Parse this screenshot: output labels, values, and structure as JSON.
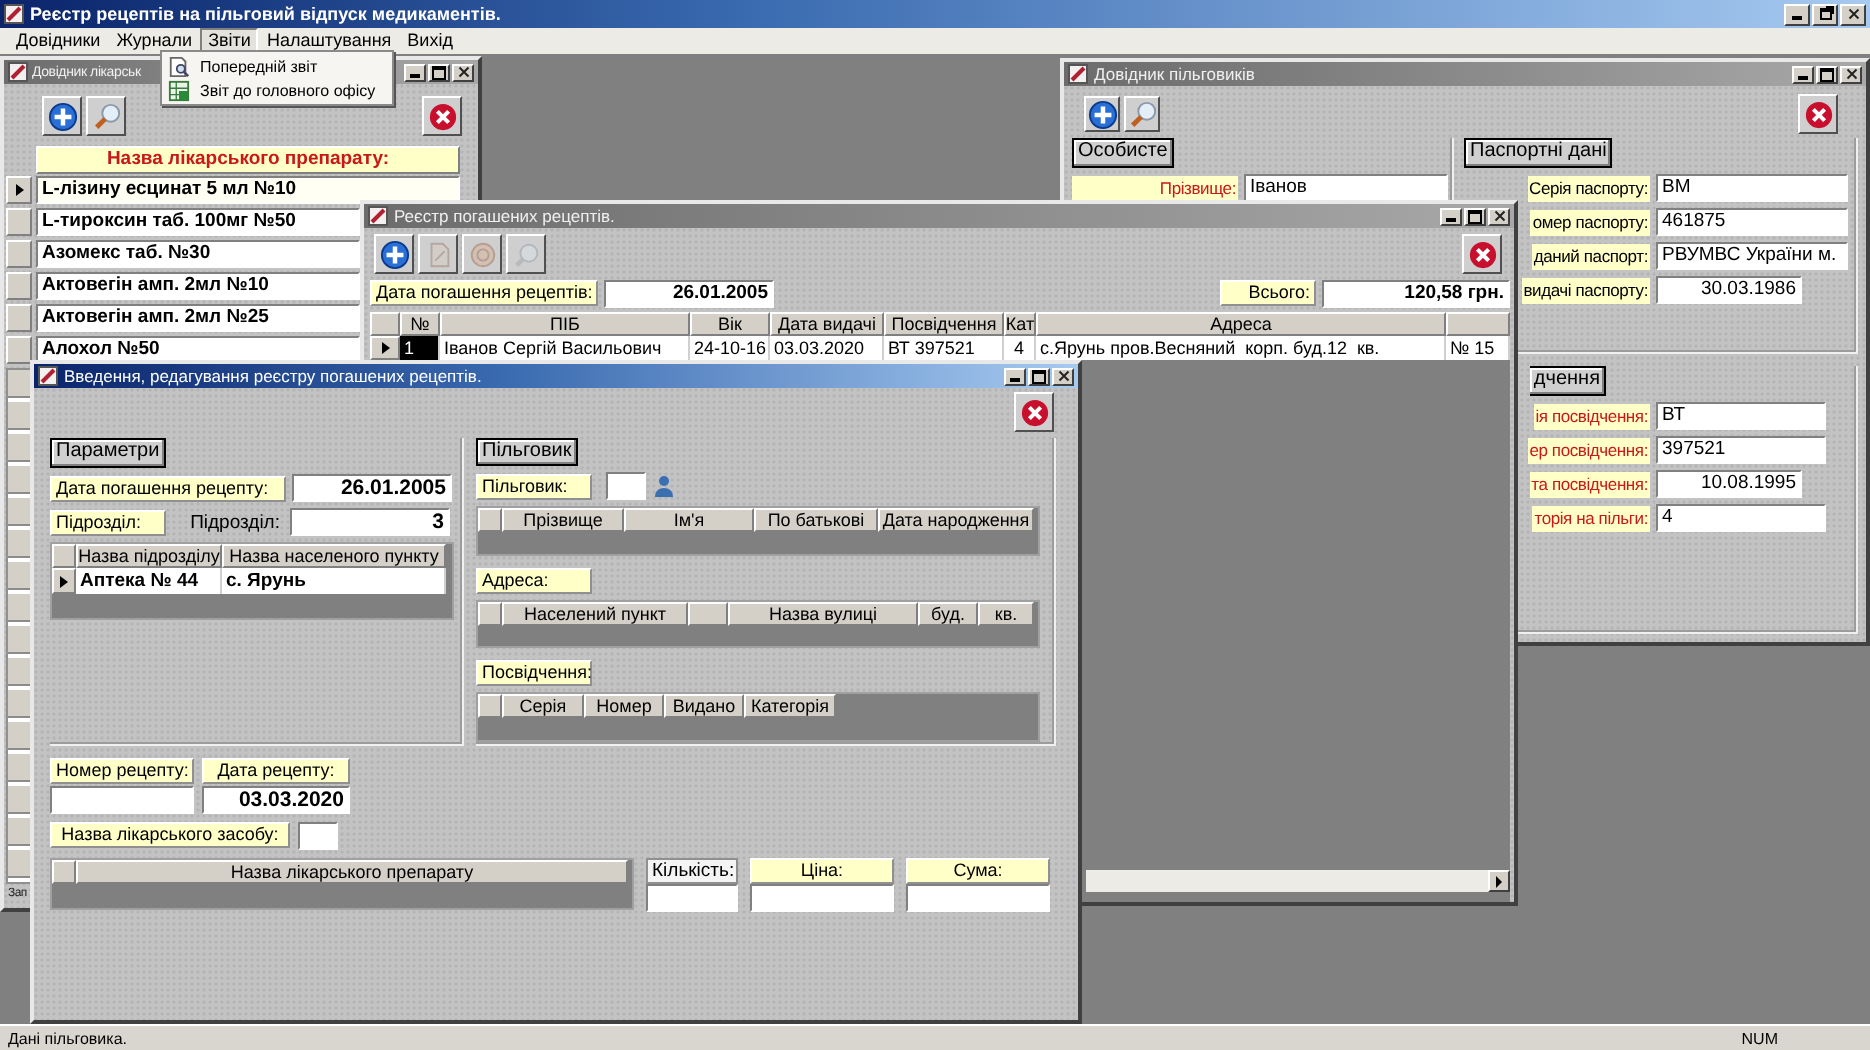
{
  "app": {
    "title": "Реєстр рецептів на пільговий відпуск медикаментів."
  },
  "menu": [
    {
      "label": "Довідники",
      "selected": false
    },
    {
      "label": "Журнали",
      "selected": false
    },
    {
      "label": "Звіти",
      "selected": true
    },
    {
      "label": "Налаштування",
      "selected": false
    },
    {
      "label": "Вихід",
      "selected": false
    }
  ],
  "dropdown": [
    {
      "label": "Попередній звіт",
      "kind": "preview"
    },
    {
      "label": "Звіт до головного офісу",
      "kind": "export"
    }
  ],
  "drug_window": {
    "title": "Довідник лікарськ",
    "active": false,
    "header": "Назва лікарського препарату:",
    "footer": "Зап",
    "rows": [
      {
        "name": "L-лізину есцинат 5 мл №10",
        "selected": true
      },
      {
        "name": "L-тироксин таб. 100мг №50",
        "selected": false
      },
      {
        "name": "Азомекс таб. №30",
        "selected": false
      },
      {
        "name": "Актовегін амп. 2мл №10",
        "selected": false
      },
      {
        "name": "Актовегін амп. 2мл №25",
        "selected": false
      },
      {
        "name": "Алохол №50",
        "selected": false
      }
    ]
  },
  "beneficiary_window": {
    "title": "Довідник пільговиків",
    "active": false,
    "personal": {
      "legend": "Особисте",
      "fields": [
        {
          "label": "Прізвище:",
          "value": "Іванов",
          "required": true
        }
      ]
    },
    "passport": {
      "legend": "Паспортні дані",
      "fields": [
        {
          "label": "Серія паспорту:",
          "value": "ВМ",
          "required": false,
          "kind": "text"
        },
        {
          "label": "омер паспорту:",
          "value": "461875",
          "required": false,
          "kind": "text"
        },
        {
          "label": "даний паспорт:",
          "value": "РВУМВС України м.",
          "required": false,
          "kind": "text"
        },
        {
          "label": "видачі паспорту:",
          "value": "30.03.1986",
          "required": false,
          "kind": "date"
        }
      ]
    },
    "certificate": {
      "legend": "дчення",
      "fields": [
        {
          "label": "ія посвідчення:",
          "value": "ВТ",
          "required": true,
          "kind": "text"
        },
        {
          "label": "ер посвідчення:",
          "value": "397521",
          "required": true,
          "kind": "text"
        },
        {
          "label": "та посвідчення:",
          "value": "10.08.1995",
          "required": true,
          "kind": "date"
        },
        {
          "label": "торія на пільги:",
          "value": "4",
          "required": true,
          "kind": "text"
        }
      ]
    }
  },
  "registry_window": {
    "title": "Реєстр погашених рецептів.",
    "active": false,
    "tools": [
      {
        "kind": "add",
        "disabled": false
      },
      {
        "kind": "edit",
        "disabled": true
      },
      {
        "kind": "delete",
        "disabled": true
      },
      {
        "kind": "search",
        "disabled": true
      }
    ],
    "date_label": "Дата погашення рецептів:",
    "date": "26.01.2005",
    "total_label": "Всього:",
    "total": "120,58 грн.",
    "columns": [
      "№",
      "ПІБ",
      "Вік",
      "Дата видачі",
      "Посвідчення",
      "Кат",
      "Адреса"
    ],
    "rows": [
      {
        "selected": true,
        "cells": [
          "1",
          "Іванов Сергій Васильович",
          "24-10-16",
          "03.03.2020",
          "ВТ 397521",
          "4",
          "с.Ярунь пров.Весняний  корп. буд.12  кв.",
          "№ 15"
        ]
      }
    ]
  },
  "entry_window": {
    "title": "Введення, редагування реєстру погашених рецептів.",
    "active": true,
    "params": {
      "legend": "Параметри",
      "date_label": "Дата погашення рецепту:",
      "date": "26.01.2005",
      "unit_label": "Підрозділ:",
      "unit_label_2": "Підрозділ:",
      "unit": "3",
      "columns": [
        "Назва підрозділу",
        "Назва населеного пункту"
      ],
      "rows": [
        {
          "selected": true,
          "cells": [
            "Аптека № 44",
            "с. Ярунь"
          ]
        }
      ]
    },
    "beneficiary": {
      "legend": "Пільговик",
      "label": "Пільговик:",
      "columns": [
        "Прізвище",
        "Ім'я",
        "По батькові",
        "Дата народження"
      ],
      "address_label": "Адреса:",
      "address_columns": [
        "Населений пункт",
        "Назва вулиці",
        "буд.",
        "кв."
      ],
      "cert_label": "Посвідчення:",
      "cert_columns": [
        "Серія",
        "Номер",
        "Видано",
        "Категорія"
      ]
    },
    "recipe_no_label": "Номер рецепту:",
    "recipe_date_label": "Дата рецепту:",
    "recipe_date": "03.03.2020",
    "drug_label": "Назва лікарського засобу:",
    "drug_column": "Назва лікарського препарату",
    "qty_label": "Кількість:",
    "price_label": "Ціна:",
    "sum_label": "Сума:"
  },
  "status": {
    "text": "Дані пільговика.",
    "num": "NUM"
  }
}
